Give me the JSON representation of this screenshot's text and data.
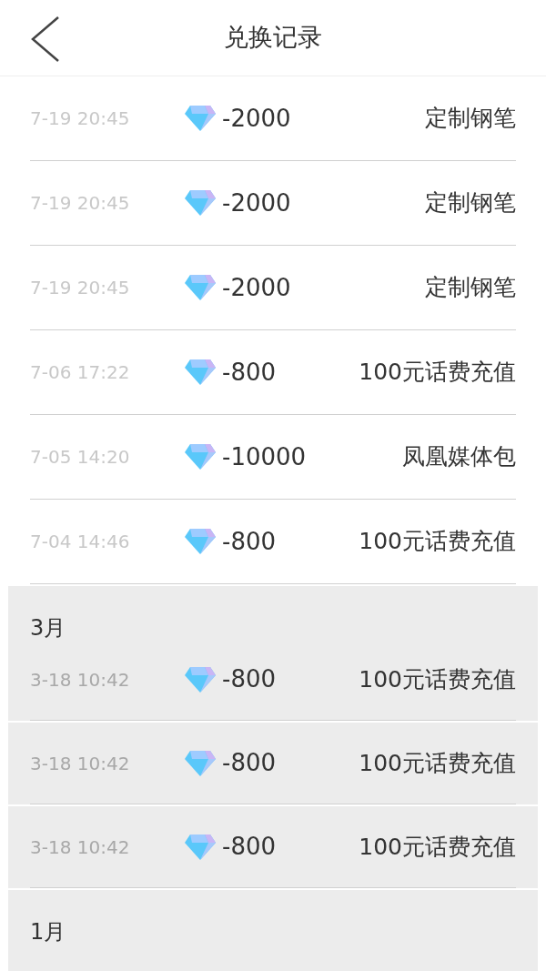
{
  "header": {
    "title": "兑换记录"
  },
  "groups": [
    {
      "records": [
        {
          "time": "7-19 20:45",
          "amount": "-2000",
          "item": "定制钢笔"
        },
        {
          "time": "7-19 20:45",
          "amount": "-2000",
          "item": "定制钢笔"
        },
        {
          "time": "7-19 20:45",
          "amount": "-2000",
          "item": "定制钢笔"
        },
        {
          "time": "7-06 17:22",
          "amount": "-800",
          "item": "100元话费充值"
        },
        {
          "time": "7-05 14:20",
          "amount": "-10000",
          "item": "凤凰媒体包"
        },
        {
          "time": "7-04 14:46",
          "amount": "-800",
          "item": "100元话费充值"
        }
      ]
    },
    {
      "month": "3月",
      "records": [
        {
          "time": "3-18 10:42",
          "amount": "-800",
          "item": "100元话费充值"
        },
        {
          "time": "3-18 10:42",
          "amount": "-800",
          "item": "100元话费充值"
        },
        {
          "time": "3-18 10:42",
          "amount": "-800",
          "item": "100元话费充值"
        }
      ]
    },
    {
      "month": "1月"
    }
  ]
}
